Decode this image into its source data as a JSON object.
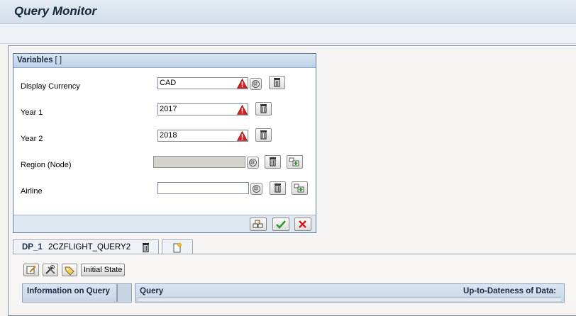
{
  "app": {
    "title": "Query Monitor"
  },
  "variables": {
    "header": "Variables",
    "header_suffix": "[ ]",
    "rows": [
      {
        "label": "Display Currency",
        "value": "CAD"
      },
      {
        "label": "Year 1",
        "value": "2017"
      },
      {
        "label": "Year 2",
        "value": "2018"
      },
      {
        "label": "Region (Node)",
        "value": ""
      },
      {
        "label": "Airline",
        "value": ""
      }
    ]
  },
  "tabs": {
    "active": {
      "name": "DP_1",
      "description": "2CZFLIGHT_QUERY2"
    }
  },
  "toolbar": {
    "initial_state_label": "Initial State"
  },
  "info_panel": {
    "header": "Information on Query",
    "query_label": "Query",
    "up_to_date_label": "Up-to-Dateness of Data:"
  },
  "colors": {
    "warning": "#d42020",
    "accent": "#1b2b45",
    "ok": "#2e9a2e",
    "cancel": "#d01818"
  }
}
